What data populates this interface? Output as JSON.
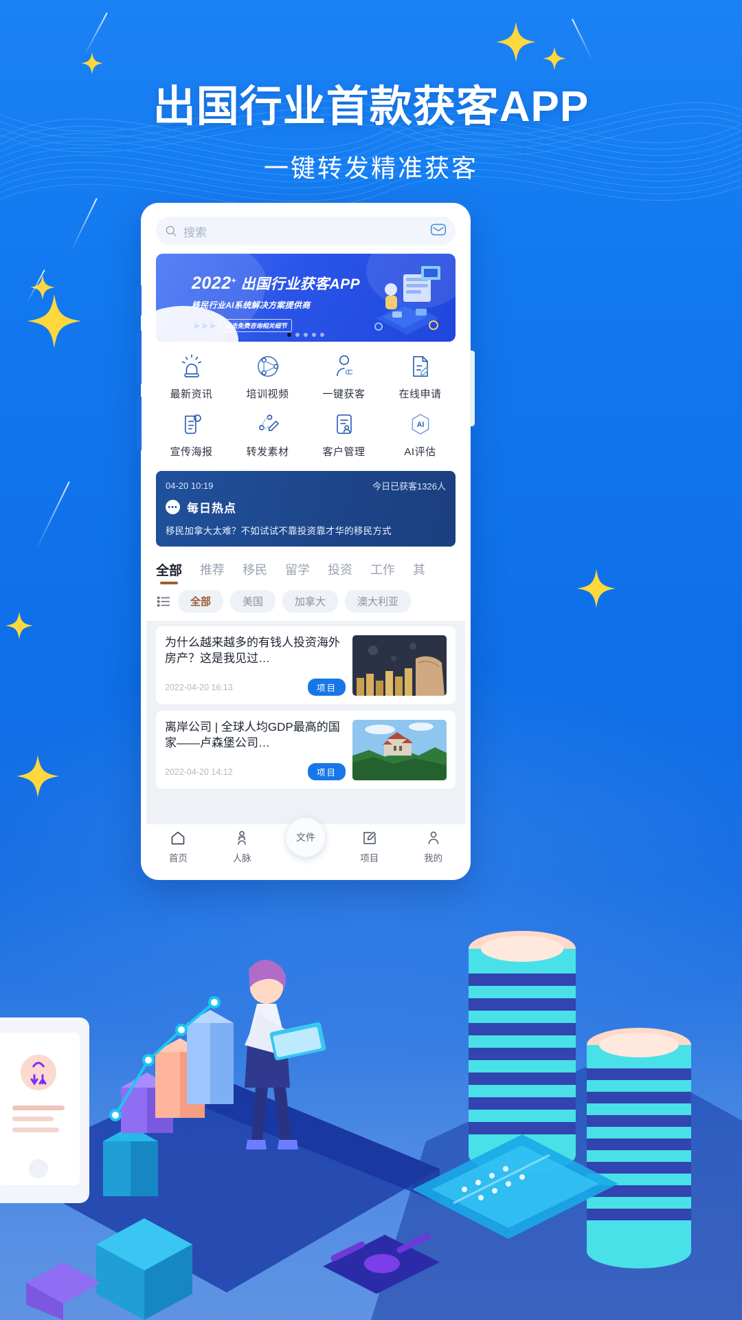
{
  "poster": {
    "headline": "出国行业首款获客APP",
    "subhead": "一键转发精准获客",
    "bg_color": "#1479f0",
    "accent_color": "#ffd83d"
  },
  "app": {
    "search": {
      "placeholder": "搜索",
      "icon": "search-icon",
      "right_icon": "mail-icon"
    },
    "banner": {
      "year": "2022",
      "plus": "+",
      "title": "出国行业获客APP",
      "subtitle": "移民行业AI系统解决方案提供商",
      "cta": "点击免费咨询相关细节",
      "arrows": "▶ ▶ ▶",
      "dots_total": 5,
      "dots_active": 0
    },
    "grid": [
      {
        "label": "最新资讯",
        "icon": "alarm-siren-icon"
      },
      {
        "label": "培训视频",
        "icon": "network-share-icon"
      },
      {
        "label": "一键获客",
        "icon": "person-link-icon"
      },
      {
        "label": "在线申请",
        "icon": "document-edit-icon"
      },
      {
        "label": "宣传海报",
        "icon": "poster-scroll-icon"
      },
      {
        "label": "转发素材",
        "icon": "share-pencil-icon"
      },
      {
        "label": "客户管理",
        "icon": "customer-card-icon"
      },
      {
        "label": "AI评估",
        "icon": "ai-badge-icon"
      }
    ],
    "hot": {
      "time": "04-20 10:19",
      "counter": "今日已获客1326人",
      "title": "每日热点",
      "desc": "移民加拿大太难？不如试试不靠投资靠才华的移民方式",
      "bg_color": "#1e4a92"
    },
    "tabs": [
      {
        "label": "全部",
        "active": true
      },
      {
        "label": "推荐",
        "active": false
      },
      {
        "label": "移民",
        "active": false
      },
      {
        "label": "留学",
        "active": false
      },
      {
        "label": "投资",
        "active": false
      },
      {
        "label": "工作",
        "active": false
      },
      {
        "label": "其",
        "active": false
      }
    ],
    "tab_accent": "#9d5c34",
    "filter_icon": "list-lines-icon",
    "chips": [
      {
        "label": "全部",
        "active": true
      },
      {
        "label": "美国",
        "active": false
      },
      {
        "label": "加拿大",
        "active": false
      },
      {
        "label": "澳大利亚",
        "active": false
      }
    ],
    "cards": [
      {
        "title": "为什么越来越多的有钱人投资海外房产？这是我见过…",
        "date": "2022-04-20 16:13",
        "badge": "项目",
        "thumb": "coins-stack-photo"
      },
      {
        "title": "离岸公司 | 全球人均GDP最高的国家——卢森堡公司…",
        "date": "2022-04-20 14:12",
        "badge": "项目",
        "thumb": "castle-photo"
      }
    ],
    "badge_color": "#1877e8",
    "bottom_nav": [
      {
        "label": "首页",
        "icon": "home-icon",
        "active": true
      },
      {
        "label": "人脉",
        "icon": "contacts-icon",
        "active": false
      },
      {
        "label": "文件",
        "icon": "file-fab",
        "active": false,
        "fab": true
      },
      {
        "label": "项目",
        "icon": "project-edit-icon",
        "active": false
      },
      {
        "label": "我的",
        "icon": "user-icon",
        "active": false
      }
    ]
  }
}
